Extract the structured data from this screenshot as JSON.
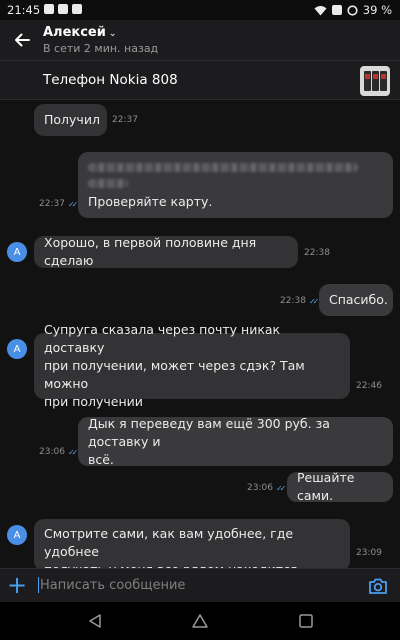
{
  "statusbar": {
    "time": "21:45",
    "battery": "39 %"
  },
  "header": {
    "contact_name": "Алексей",
    "status": "В сети 2 мин. назад"
  },
  "item": {
    "title": "Телефон Nokia 808"
  },
  "avatar_letter": "А",
  "messages": [
    {
      "dir": "in",
      "lines": [
        "Получил"
      ],
      "time": "22:37"
    },
    {
      "dir": "out",
      "lines": [
        "Проверяйте карту."
      ],
      "time": "22:37",
      "read": true,
      "redacted": true
    },
    {
      "dir": "in",
      "lines": [
        "Хорошо, в первой половине дня сделаю"
      ],
      "time": "22:38"
    },
    {
      "dir": "out",
      "lines": [
        "Спасибо."
      ],
      "time": "22:38",
      "read": true
    },
    {
      "dir": "in",
      "lines": [
        "Супруга сказала через почту никак доставку",
        "при получении, может через сдэк? Там можно",
        "при получении"
      ],
      "time": "22:46"
    },
    {
      "dir": "out",
      "lines": [
        "Дык я переведу вам ещё 300 руб. за доставку и",
        "всё."
      ],
      "time": "23:06",
      "read": true
    },
    {
      "dir": "out",
      "lines": [
        "Решайте сами."
      ],
      "time": "23:06",
      "read": true
    },
    {
      "dir": "in",
      "lines": [
        "Смотрите сами, как вам удобнее, где удобнее",
        "получать,у меня все рядом находится"
      ],
      "time": "23:09"
    }
  ],
  "composer": {
    "placeholder": "Написать сообщение"
  },
  "colors": {
    "accent": "#4a9ef0",
    "avatar": "#4a8fe7",
    "background": "#121212",
    "bubble": "#333335"
  },
  "icons": [
    "back-arrow-icon",
    "chevron-down-icon",
    "plus-icon",
    "camera-icon",
    "nav-back-icon",
    "nav-home-icon",
    "nav-recents-icon"
  ]
}
